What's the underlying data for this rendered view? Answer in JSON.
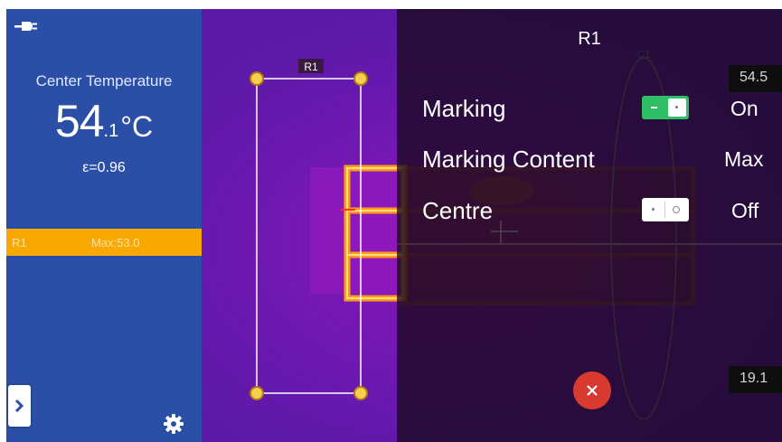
{
  "left_panel": {
    "center_label": "Center Temperature",
    "temperature_int": "54",
    "temperature_dec": ".1",
    "temperature_unit": "°C",
    "emissivity": "ε=0.96",
    "roi_bar": {
      "name": "R1",
      "max": "Max:53.0",
      "color": "#f8a800"
    },
    "icons": {
      "power": "plug-icon",
      "expand": "chevron-right-icon",
      "settings": "gear-icon"
    }
  },
  "thermal_view": {
    "roi_label": "R1",
    "ellipse_label": "C1"
  },
  "overlay": {
    "title": "R1",
    "rows": [
      {
        "label": "Marking",
        "value": "On",
        "toggle": "on"
      },
      {
        "label": "Marking Content",
        "value": "Max"
      },
      {
        "label": "Centre",
        "value": "Off",
        "toggle": "off"
      }
    ],
    "close_icon": "close-icon"
  },
  "scale": {
    "max": "54.5",
    "min": "19.1"
  },
  "colors": {
    "panel": "#2b4fa7",
    "accent": "#f8a800",
    "toggle_on": "#2fbf67",
    "close": "#d93a2f"
  }
}
